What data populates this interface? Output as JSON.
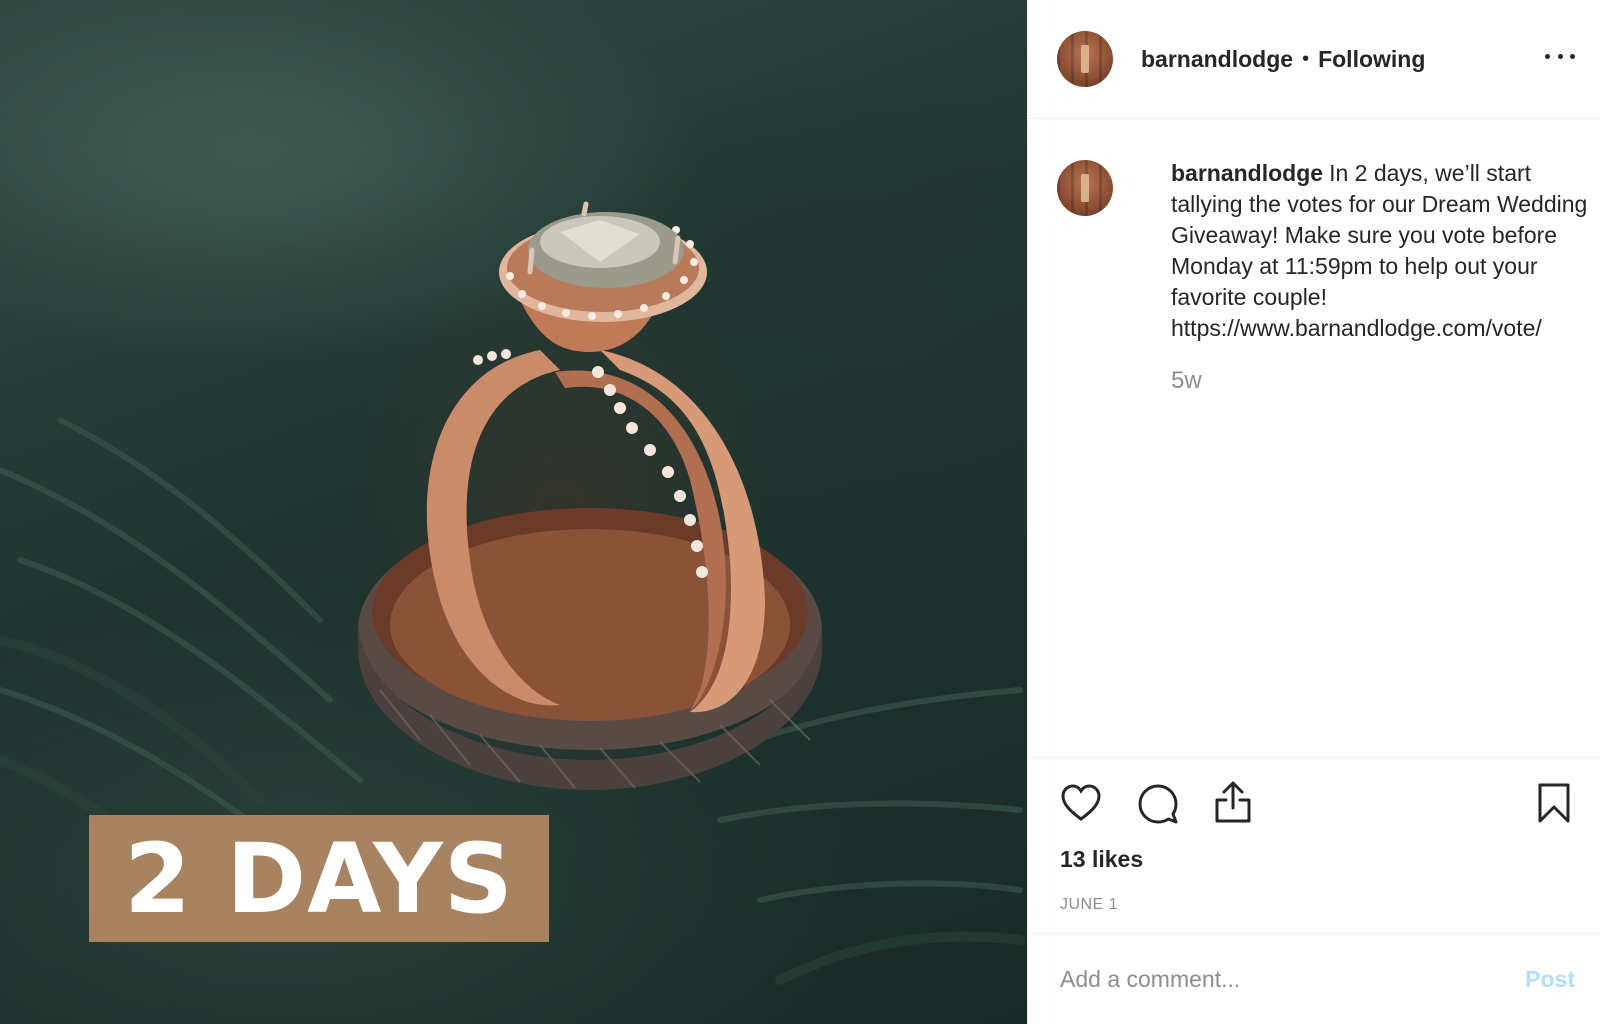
{
  "photo": {
    "badge_text": "2 DAYS",
    "badge_color": "#a88361"
  },
  "header": {
    "username": "barnandlodge",
    "separator": "•",
    "follow_status": "Following",
    "more_icon": "more-horizontal-icon"
  },
  "caption": {
    "username": "barnandlodge",
    "text": "In 2 days, we’ll start tallying the votes for our Dream Wedding Giveaway! Make sure you vote before Monday at 11:59pm to help out your favorite couple!",
    "link": "https://www.barnandlodge.com/vote/",
    "time_ago": "5w"
  },
  "actions": {
    "like_icon": "heart-icon",
    "comment_icon": "comment-icon",
    "share_icon": "share-icon",
    "save_icon": "bookmark-icon",
    "likes": "13 likes",
    "date": "JUNE 1"
  },
  "comment": {
    "placeholder": "Add a comment...",
    "post_label": "Post",
    "post_color": "#b2dffc"
  }
}
